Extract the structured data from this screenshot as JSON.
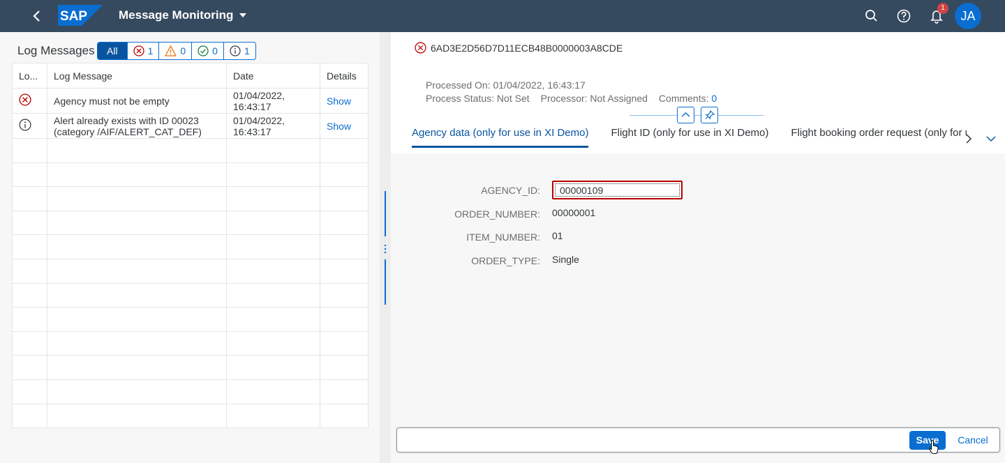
{
  "shell": {
    "logo": "SAP",
    "title": "Message Monitoring",
    "notification_count": "1",
    "user_initials": "JA"
  },
  "log": {
    "title": "Log Messages",
    "filters": [
      {
        "label": "All"
      },
      {
        "icon": "error-icon",
        "count": "1"
      },
      {
        "icon": "warning-icon",
        "count": "0"
      },
      {
        "icon": "success-icon",
        "count": "0"
      },
      {
        "icon": "info-icon",
        "count": "1"
      }
    ],
    "columns": [
      "Lo...",
      "Log Message",
      "Date",
      "Details"
    ],
    "rows": [
      {
        "type": "error-icon",
        "message": "Agency must not be empty",
        "date_line1": "01/04/2022,",
        "date_line2": "16:43:17",
        "details": "Show"
      },
      {
        "type": "info-icon",
        "message_line1": "Alert already exists with ID 00023",
        "message_line2": "(category /AIF/ALERT_CAT_DEF)",
        "date_line1": "01/04/2022,",
        "date_line2": "16:43:17",
        "details": "Show"
      }
    ]
  },
  "detail": {
    "message_id": "6AD3E2D56D7D11ECB48B0000003A8CDE",
    "processed_on": "Processed On: 01/04/2022, 16:43:17",
    "process_status": "Process Status: Not Set",
    "processor": "Processor: Not Assigned",
    "comments_label": "Comments:",
    "comments_count": "0",
    "tabs": [
      "Agency data (only for use in XI Demo)",
      "Flight ID (only for use in XI Demo)",
      "Flight booking order request (only for use in XI Demo)"
    ],
    "fields": [
      {
        "label": "AGENCY_ID:",
        "value": "00000109"
      },
      {
        "label": "ORDER_NUMBER:",
        "value": "00000001"
      },
      {
        "label": "ITEM_NUMBER:",
        "value": "01"
      },
      {
        "label": "ORDER_TYPE:",
        "value": "Single"
      }
    ]
  },
  "footer": {
    "save_label": "Save",
    "cancel_label": "Cancel"
  },
  "colors": {
    "shell": "#354a5f",
    "accent": "#0a6ed1",
    "error": "#bb0000",
    "warning": "#e9730c",
    "success": "#107e3e"
  }
}
